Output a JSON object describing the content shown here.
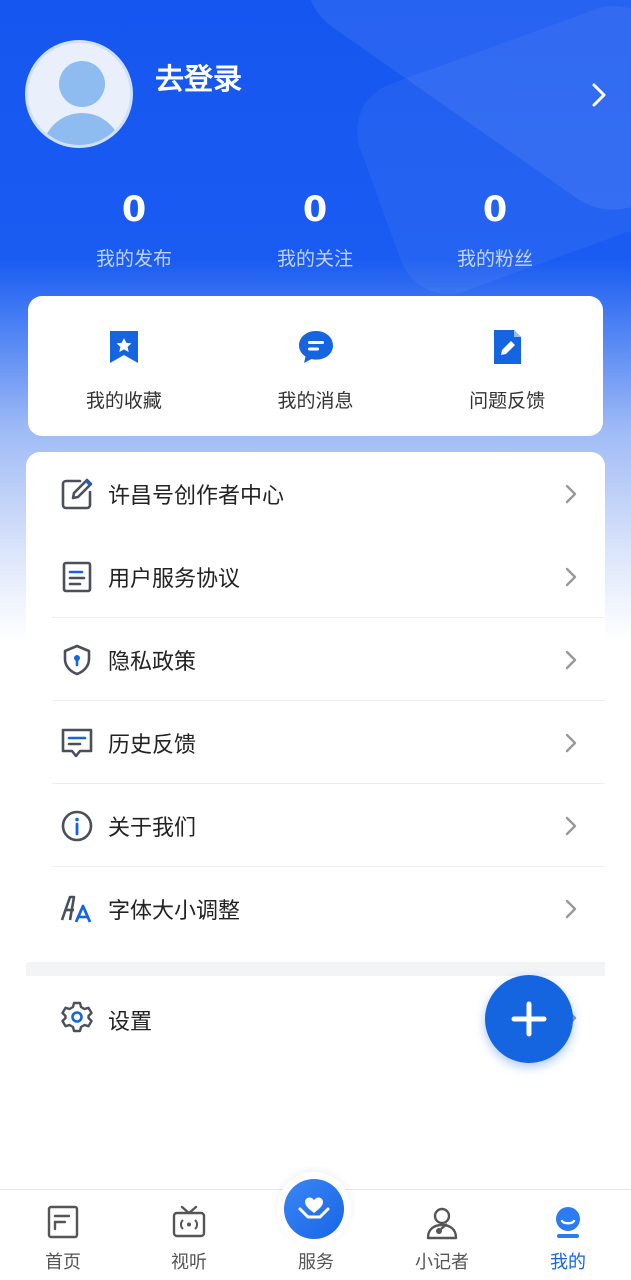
{
  "header": {
    "login_label": "去登录"
  },
  "stats": [
    {
      "value": "0",
      "label": "我的发布"
    },
    {
      "value": "0",
      "label": "我的关注"
    },
    {
      "value": "0",
      "label": "我的粉丝"
    }
  ],
  "quick_actions": [
    {
      "label": "我的收藏",
      "icon": "bookmark-star-icon"
    },
    {
      "label": "我的消息",
      "icon": "chat-bubble-icon"
    },
    {
      "label": "问题反馈",
      "icon": "document-edit-icon"
    }
  ],
  "menu": [
    {
      "label": "许昌号创作者中心",
      "icon": "edit-square-icon"
    },
    {
      "label": "用户服务协议",
      "icon": "document-icon"
    },
    {
      "label": "隐私政策",
      "icon": "shield-icon"
    },
    {
      "label": "历史反馈",
      "icon": "message-icon"
    },
    {
      "label": "关于我们",
      "icon": "info-icon"
    },
    {
      "label": "字体大小调整",
      "icon": "font-size-icon"
    }
  ],
  "settings": {
    "label": "设置",
    "icon": "gear-icon"
  },
  "fab": {
    "icon": "plus-icon"
  },
  "tabbar": [
    {
      "label": "首页",
      "icon": "home-doc-icon",
      "active": false
    },
    {
      "label": "视听",
      "icon": "tv-icon",
      "active": false
    },
    {
      "label": "服务",
      "icon": "heart-hands-icon",
      "active": false
    },
    {
      "label": "小记者",
      "icon": "reporter-icon",
      "active": false
    },
    {
      "label": "我的",
      "icon": "profile-icon",
      "active": true
    }
  ],
  "colors": {
    "brand_blue": "#1556f0",
    "accent": "#1565e0",
    "icon_gray": "#4a4f5a"
  }
}
